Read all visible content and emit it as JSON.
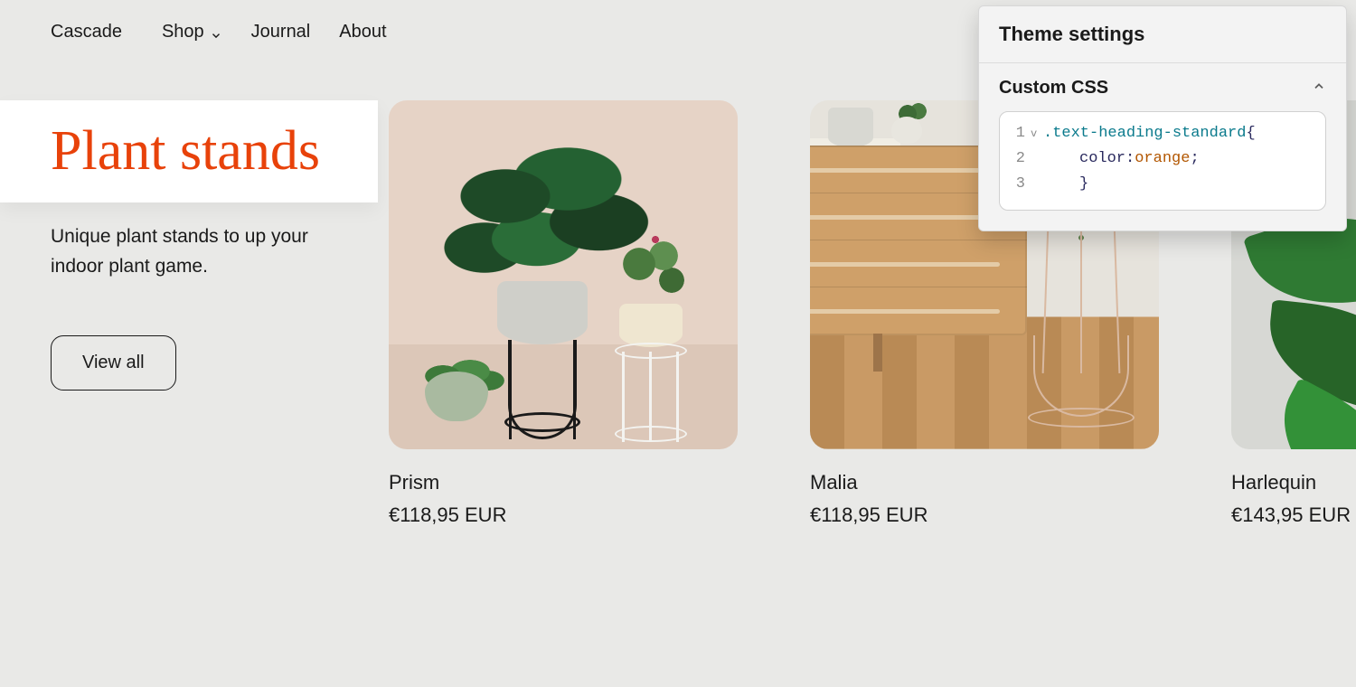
{
  "nav": {
    "brand": "Cascade",
    "items": [
      {
        "label": "Shop",
        "has_dropdown": true
      },
      {
        "label": "Journal",
        "has_dropdown": false
      },
      {
        "label": "About",
        "has_dropdown": false
      }
    ]
  },
  "section": {
    "heading": "Plant stands",
    "subtext": "Unique plant stands to up your indoor plant game.",
    "view_all_label": "View all",
    "heading_color": "#e8420a"
  },
  "products": [
    {
      "name": "Prism",
      "price": "€118,95 EUR"
    },
    {
      "name": "Malia",
      "price": "€118,95 EUR"
    },
    {
      "name": "Harlequin",
      "price": "€143,95 EUR"
    }
  ],
  "panel": {
    "title": "Theme settings",
    "section_title": "Custom CSS",
    "code": {
      "line1_selector": ".text-heading-standard",
      "line1_brace": " {",
      "line2_prop": "color",
      "line2_colon": ": ",
      "line2_value": "orange",
      "line2_semicolon": ";",
      "line3_brace": "}"
    }
  }
}
